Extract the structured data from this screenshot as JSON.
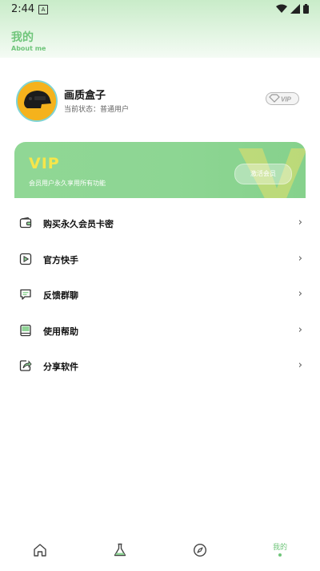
{
  "status_bar": {
    "time": "2:44",
    "notification_glyph": "A",
    "icons": [
      "wifi-icon",
      "signal-icon",
      "battery-icon"
    ]
  },
  "header": {
    "title": "我的",
    "subtitle": "About me",
    "accent_color": "#6fc57a"
  },
  "profile": {
    "name": "画质盒子",
    "status": "当前状态：普通用户",
    "badge": "VIP",
    "avatar": "helmet-avatar"
  },
  "vip_card": {
    "title": "VIP",
    "description": "会员用户永久享用所有功能",
    "button_label": "激活会员",
    "colors": {
      "background": "#8dd693",
      "title": "#f6e64a"
    }
  },
  "menu": {
    "items": [
      {
        "label": "购买永久会员卡密",
        "icon": "wallet-icon"
      },
      {
        "label": "官方快手",
        "icon": "video-play-icon"
      },
      {
        "label": "反馈群聊",
        "icon": "chat-icon"
      },
      {
        "label": "使用帮助",
        "icon": "book-icon"
      },
      {
        "label": "分享软件",
        "icon": "share-icon"
      }
    ],
    "arrow": "›"
  },
  "bottom_nav": {
    "items": [
      {
        "icon": "home-icon",
        "label": ""
      },
      {
        "icon": "flask-icon",
        "label": ""
      },
      {
        "icon": "compass-icon",
        "label": ""
      },
      {
        "icon": "",
        "label": "我的",
        "active": true
      }
    ]
  }
}
